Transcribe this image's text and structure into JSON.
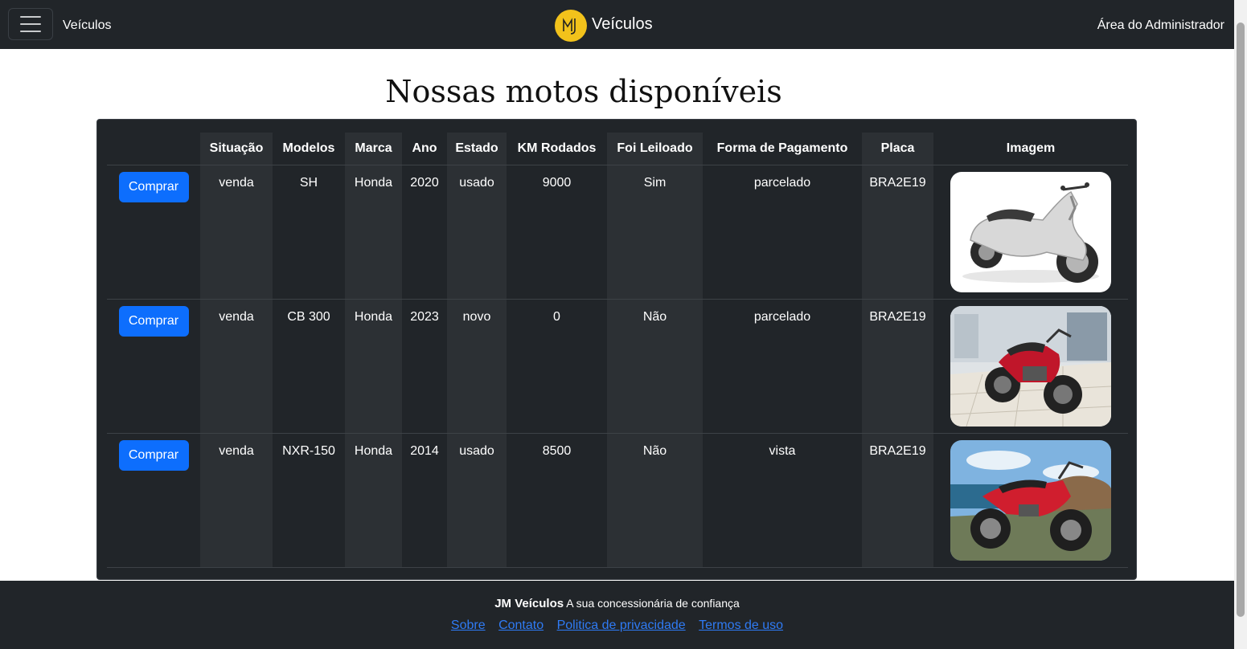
{
  "nav": {
    "menu_icon": "hamburger-icon",
    "left_link": "Veículos",
    "brand_logo": "jm-logo",
    "brand_text": "Veículos",
    "right_link": "Área do Administrador"
  },
  "page": {
    "title": "Nossas motos disponíveis"
  },
  "table": {
    "headers": [
      "",
      "Situação",
      "Modelos",
      "Marca",
      "Ano",
      "Estado",
      "KM Rodados",
      "Foi Leiloado",
      "Forma de Pagamento",
      "Placa",
      "Imagem"
    ],
    "rows": [
      {
        "button": "Comprar",
        "situacao": "venda",
        "modelo": "SH",
        "marca": "Honda",
        "ano": "2020",
        "estado": "usado",
        "km": "9000",
        "leiloado": "Sim",
        "pagamento": "parcelado",
        "placa": "BRA2E19",
        "image": "white-scooter-photo"
      },
      {
        "button": "Comprar",
        "situacao": "venda",
        "modelo": "CB 300",
        "marca": "Honda",
        "ano": "2023",
        "estado": "novo",
        "km": "0",
        "leiloado": "Não",
        "pagamento": "parcelado",
        "placa": "BRA2E19",
        "image": "red-street-motorcycle-photo"
      },
      {
        "button": "Comprar",
        "situacao": "venda",
        "modelo": "NXR-150",
        "marca": "Honda",
        "ano": "2014",
        "estado": "usado",
        "km": "8500",
        "leiloado": "Não",
        "pagamento": "vista",
        "placa": "BRA2E19",
        "image": "red-trail-motorcycle-photo"
      }
    ]
  },
  "footer": {
    "brand": "JM Veículos",
    "tagline": "A sua concessionária de confiança",
    "links": [
      "Sobre",
      "Contato",
      "Politica de privacidade",
      "Termos de uso"
    ]
  },
  "colors": {
    "dark_bg": "#212529",
    "stripe": "#2c3034",
    "primary_button": "#0d6efd",
    "link": "#2f7bf5",
    "logo_yellow": "#f2c21b"
  }
}
